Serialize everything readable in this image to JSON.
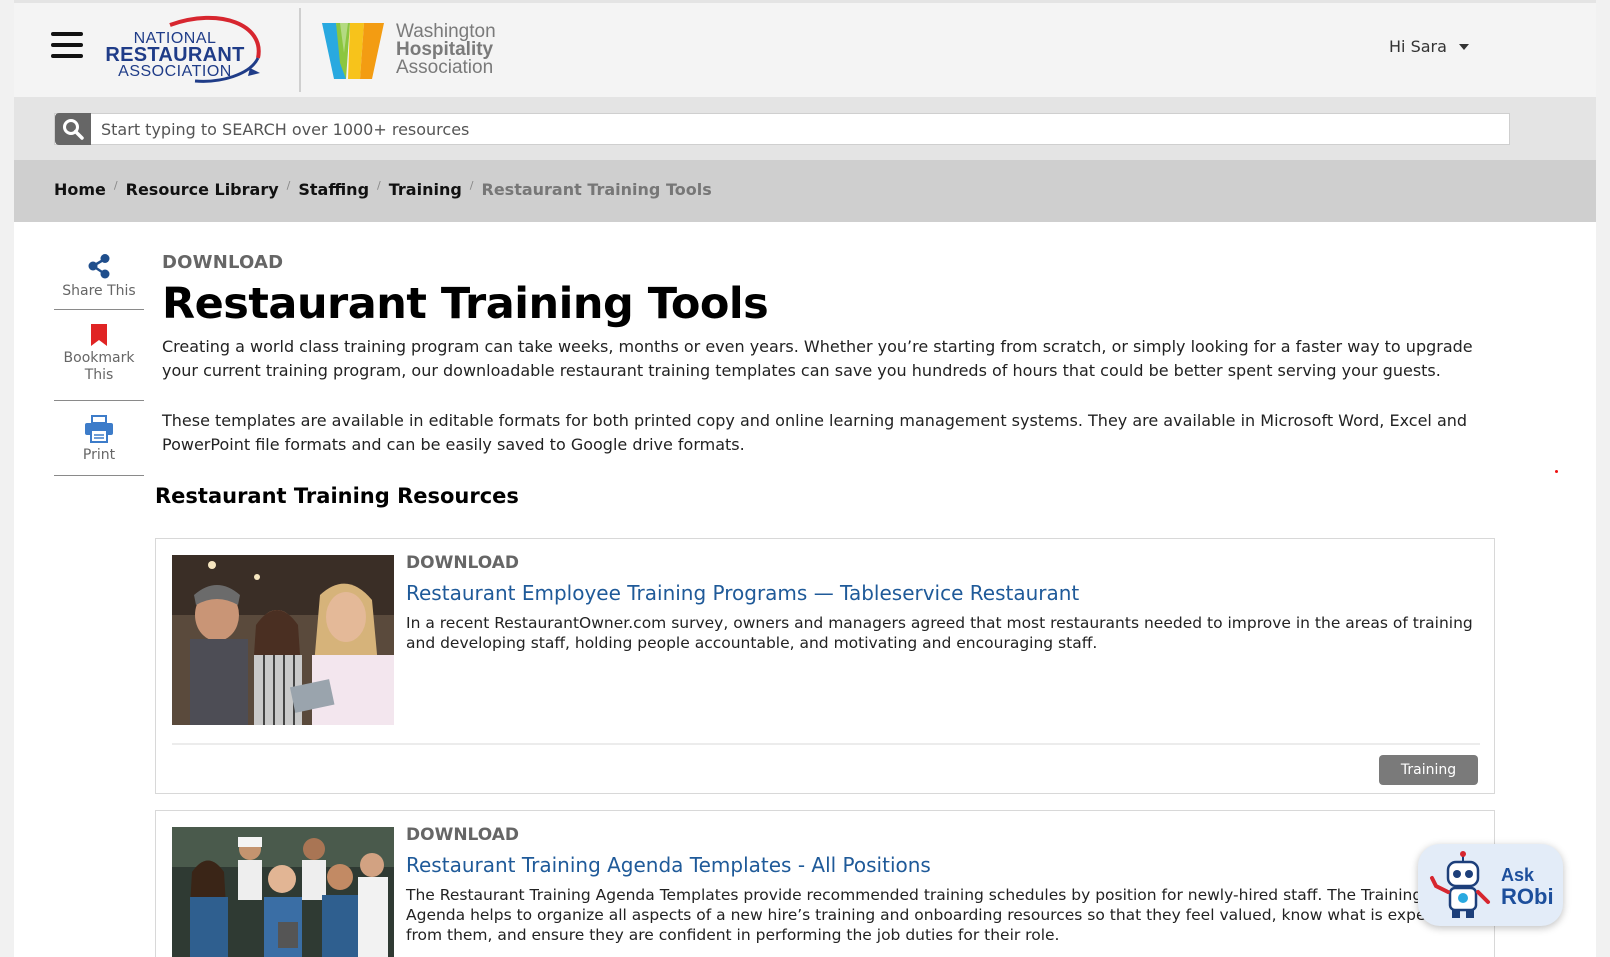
{
  "header": {
    "nra_logo": {
      "line1": "NATIONAL",
      "line2": "RESTAURANT",
      "line3": "ASSOCIATION"
    },
    "wha_logo": {
      "line1": "Washington",
      "line2": "Hospitality",
      "line3": "Association"
    },
    "user_greeting": "Hi Sara"
  },
  "search": {
    "placeholder": "Start typing to SEARCH over 1000+ resources",
    "icon": "search-icon"
  },
  "breadcrumb": {
    "items": [
      "Home",
      "Resource Library",
      "Staffing",
      "Training"
    ],
    "current": "Restaurant Training Tools"
  },
  "side_actions": {
    "share": "Share This",
    "bookmark_line1": "Bookmark",
    "bookmark_line2": "This",
    "print": "Print"
  },
  "main": {
    "kicker": "DOWNLOAD",
    "title": "Restaurant Training Tools",
    "intro_1": "Creating a world class training program can take weeks, months or even years. Whether you’re starting from scratch, or simply looking for a faster way to upgrade your current training program, our downloadable restaurant training templates can save you hundreds of hours that could be better spent serving your guests.",
    "intro_2": "These templates are available in editable formats for both printed copy and online learning management systems. They are available in Microsoft Word, Excel and PowerPoint file formats and can be easily saved to Google drive formats.",
    "section_heading": "Restaurant Training Resources"
  },
  "cards": [
    {
      "kicker": "DOWNLOAD",
      "title": "Restaurant Employee Training Programs — Tableservice Restaurant",
      "description": "In a recent RestaurantOwner.com survey, owners and managers agreed that most restaurants needed to improve in the areas of training and developing staff, holding people accountable, and motivating and encouraging staff.",
      "tag": "Training"
    },
    {
      "kicker": "DOWNLOAD",
      "title": "Restaurant Training Agenda Templates - All Positions",
      "description": "The Restaurant Training Agenda Templates provide recommended training schedules by position for newly-hired staff. The Training Agenda helps to organize all aspects of a new hire’s training and onboarding resources so that they feel valued, know what is expected from them, and ensure they are confident in performing the job duties for their role."
    }
  ],
  "chat_widget": {
    "ask": "Ask",
    "name": "RObi"
  },
  "colors": {
    "link": "#1f5a99",
    "brand_blue": "#1f3c88",
    "brand_red": "#d7262f",
    "bookmark_red": "#e02424"
  }
}
